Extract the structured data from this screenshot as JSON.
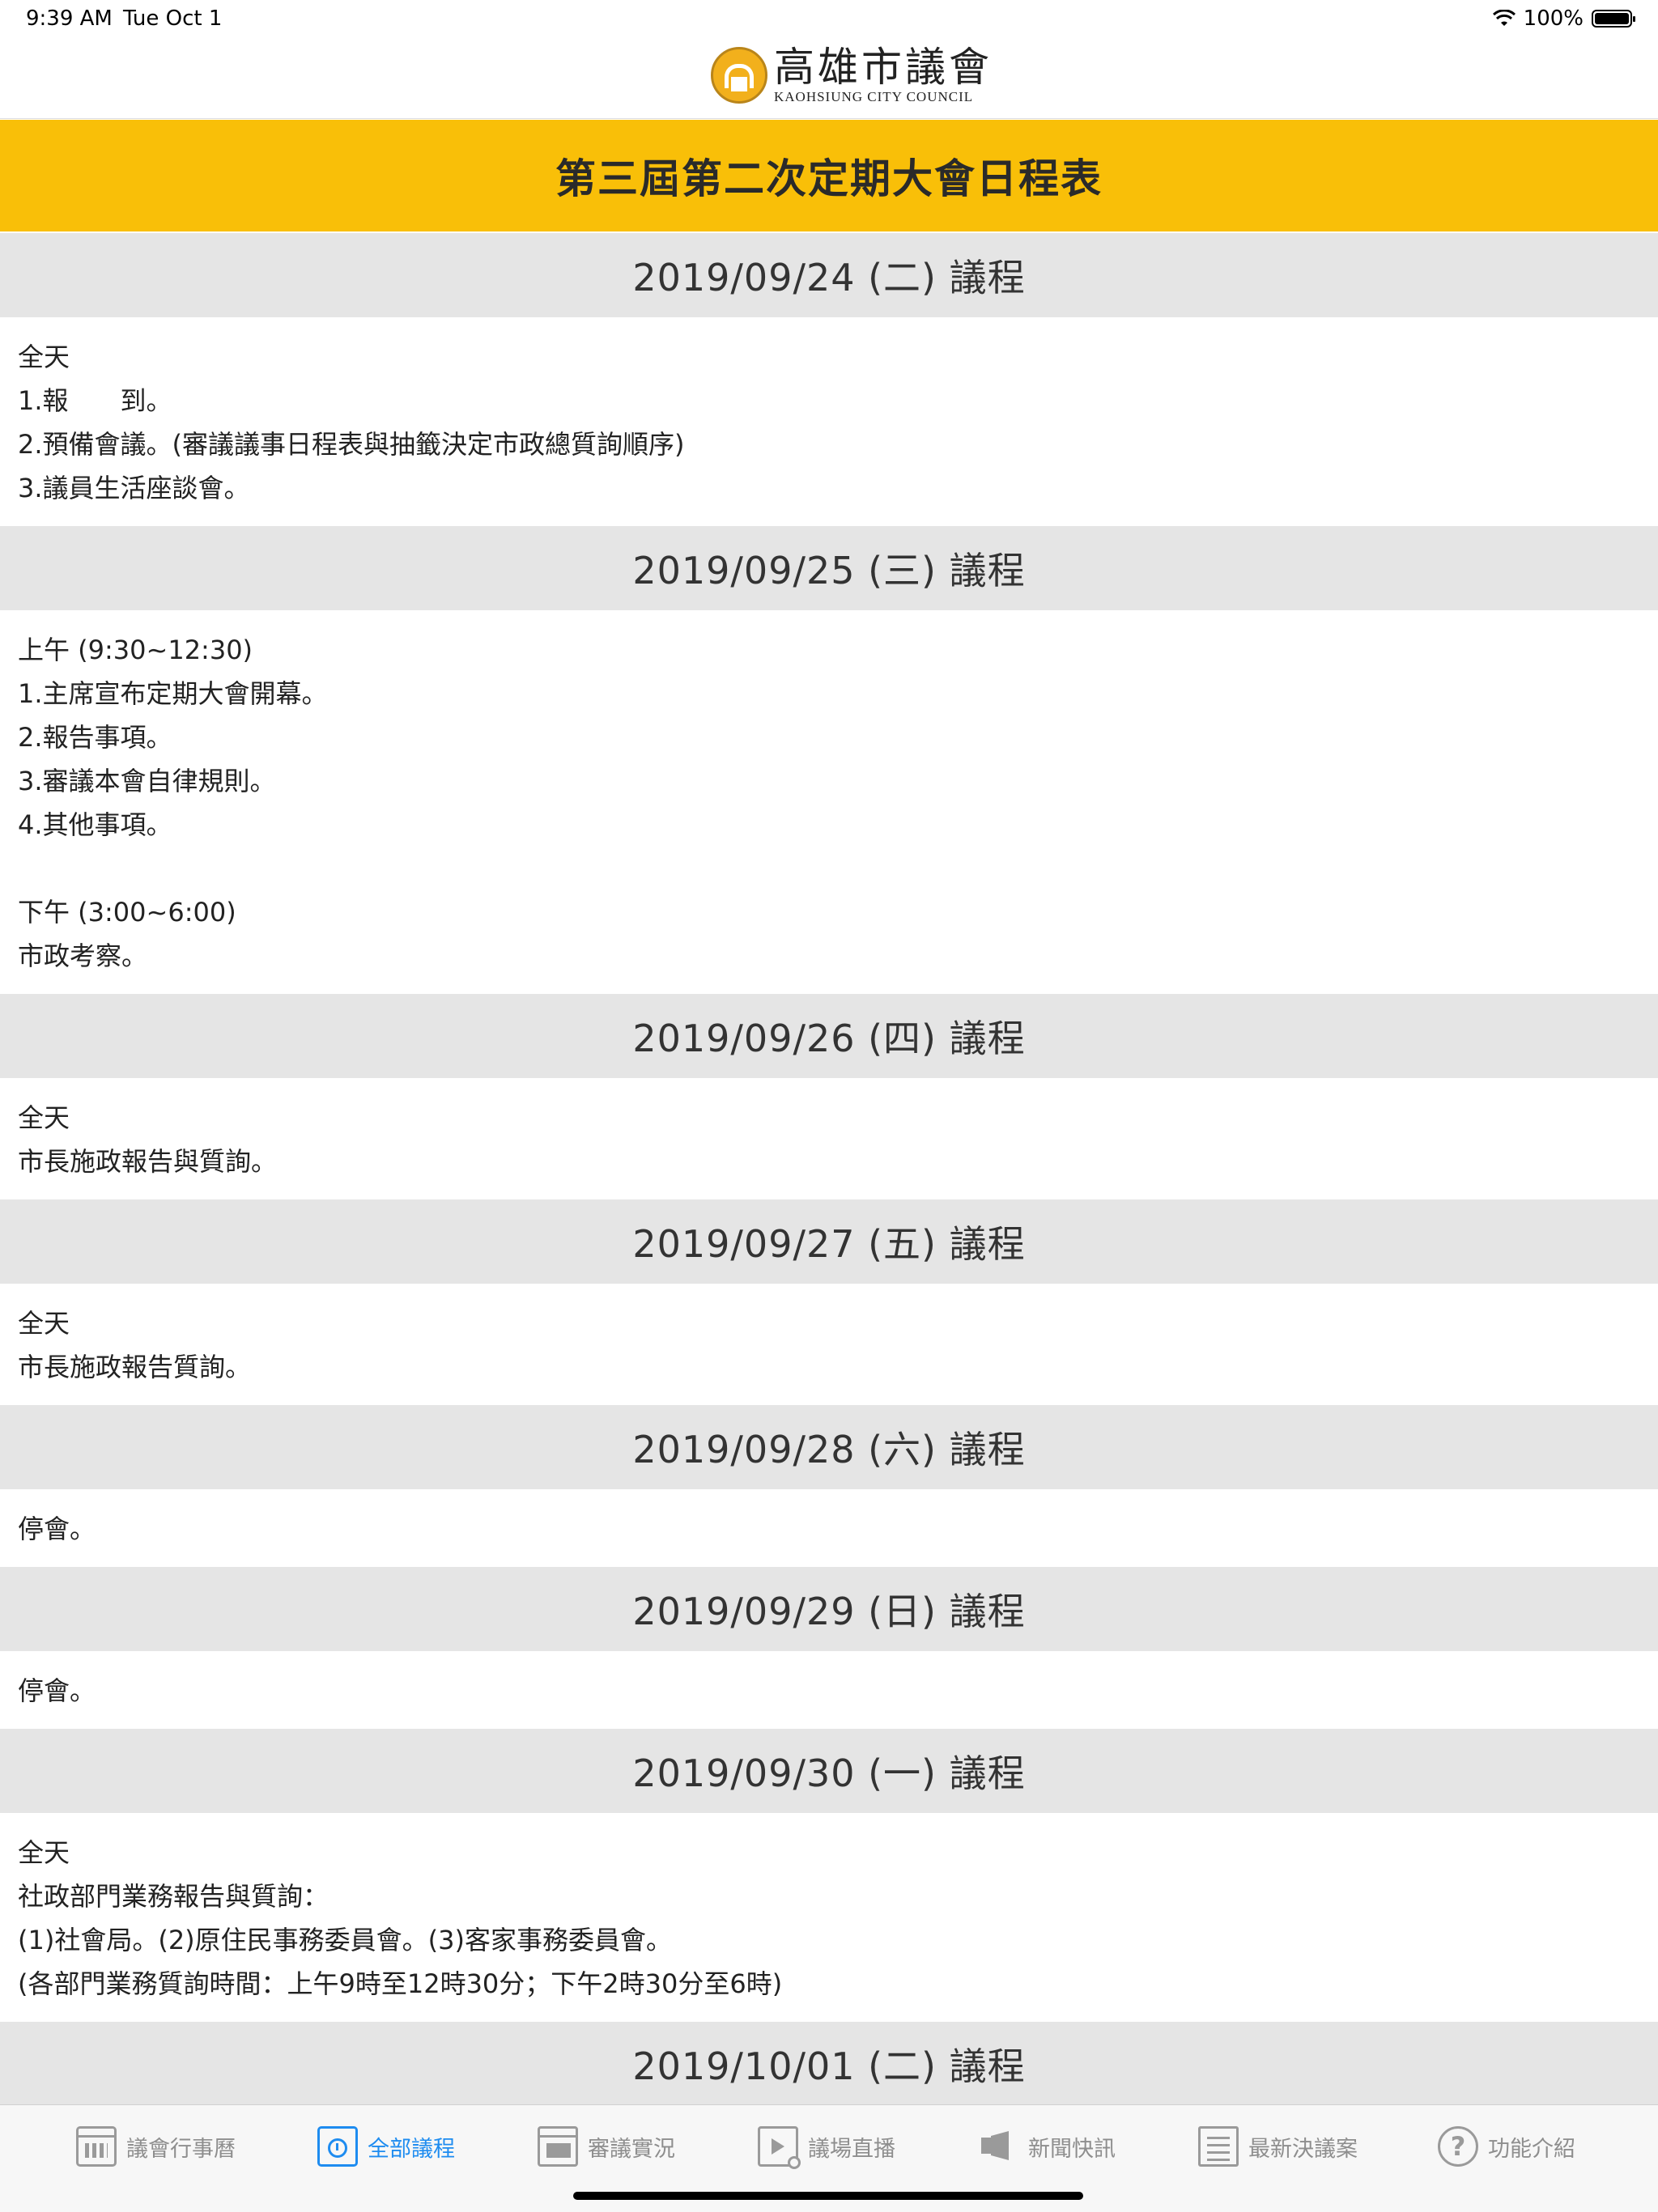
{
  "status_bar": {
    "time": "9:39 AM",
    "date": "Tue Oct 1",
    "battery": "100%"
  },
  "header": {
    "logo_cn": "高雄市議會",
    "logo_en": "KAOHSIUNG CITY COUNCIL"
  },
  "title": "第三屆第二次定期大會日程表",
  "days": [
    {
      "date": "2019/09/24 (二) 議程",
      "lines": [
        "全天",
        "1.報　　到。",
        "2.預備會議。(審議議事日程表與抽籤決定市政總質詢順序)",
        "3.議員生活座談會。"
      ]
    },
    {
      "date": "2019/09/25 (三) 議程",
      "lines": [
        "上午 (9:30~12:30)",
        "1.主席宣布定期大會開幕。",
        "2.報告事項。",
        "3.審議本會自律規則。",
        "4.其他事項。",
        "",
        "下午 (3:00~6:00)",
        "市政考察。"
      ]
    },
    {
      "date": "2019/09/26 (四) 議程",
      "lines": [
        "全天",
        "市長施政報告與質詢。"
      ]
    },
    {
      "date": "2019/09/27 (五) 議程",
      "lines": [
        "全天",
        "市長施政報告質詢。"
      ]
    },
    {
      "date": "2019/09/28 (六) 議程",
      "lines": [
        "停會。"
      ]
    },
    {
      "date": "2019/09/29 (日) 議程",
      "lines": [
        "停會。"
      ]
    },
    {
      "date": "2019/09/30 (一) 議程",
      "lines": [
        "全天",
        "社政部門業務報告與質詢：",
        "(1)社會局。(2)原住民事務委員會。(3)客家事務委員會。",
        "(各部門業務質詢時間：上午9時至12時30分；下午2時30分至6時)"
      ]
    },
    {
      "date": "2019/10/01 (二) 議程",
      "lines": []
    }
  ],
  "tabs": [
    {
      "label": "議會行事曆",
      "icon": "calendar-icon"
    },
    {
      "label": "全部議程",
      "icon": "clock-calendar-icon"
    },
    {
      "label": "審議實況",
      "icon": "window-icon"
    },
    {
      "label": "議場直播",
      "icon": "video-play-icon"
    },
    {
      "label": "新聞快訊",
      "icon": "megaphone-icon"
    },
    {
      "label": "最新決議案",
      "icon": "document-icon"
    },
    {
      "label": "功能介紹",
      "icon": "help-icon"
    }
  ],
  "active_tab": "全部議程",
  "colors": {
    "banner": "#f9bf08",
    "day_header_bg": "#e5e5e5",
    "active_tab": "#1e8cf0",
    "inactive_tab": "#8e8e8e"
  }
}
